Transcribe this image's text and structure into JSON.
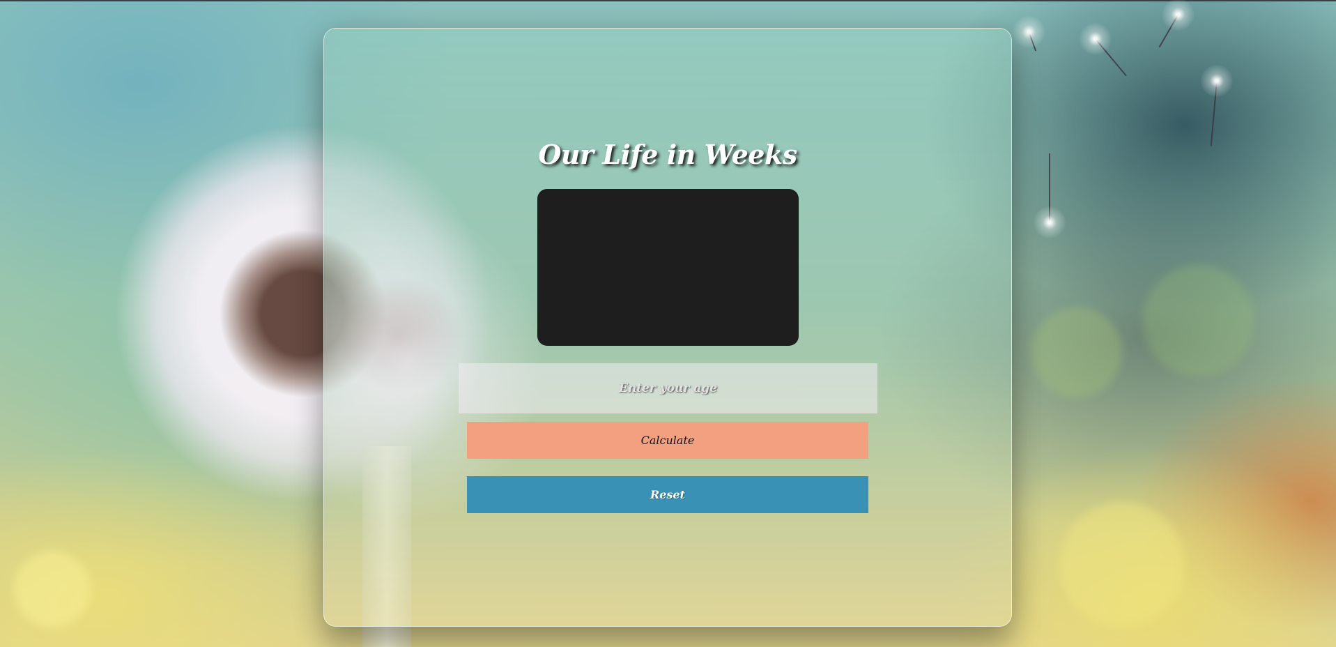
{
  "app": {
    "title": "Our Life in Weeks"
  },
  "form": {
    "age_placeholder": "Enter your age",
    "age_value": "",
    "calculate_label": "Calculate",
    "reset_label": "Reset"
  },
  "colors": {
    "display_bg": "#1e1e1e",
    "calculate_bg": "#f2a07f",
    "reset_bg": "#3992b5"
  },
  "icons": {
    "background": "dandelion-photo"
  }
}
